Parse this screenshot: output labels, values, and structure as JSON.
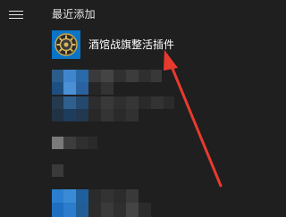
{
  "header": {
    "menu_icon": "hamburger-menu-icon",
    "section_title": "最近添加"
  },
  "recent_app": {
    "label": "酒馆战旗整活插件",
    "icon": "gear-app-icon"
  },
  "colors": {
    "background": "#1f1f1f",
    "tile_blue": "#0a74c7",
    "arrow_red": "#e83a2e"
  }
}
